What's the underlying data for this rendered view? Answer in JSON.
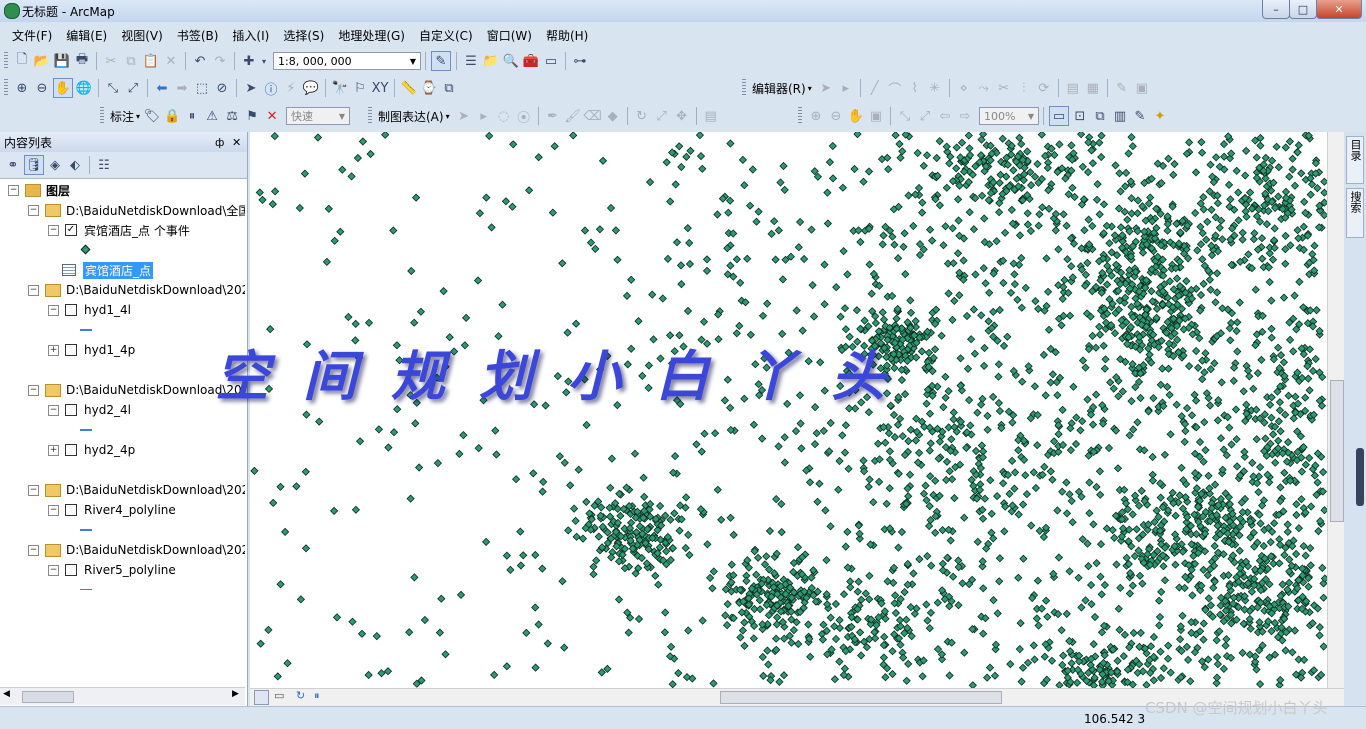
{
  "window": {
    "title": "无标题 - ArcMap",
    "minimize": "–",
    "maximize": "□",
    "close": "✕"
  },
  "menu": [
    "文件(F)",
    "编辑(E)",
    "视图(V)",
    "书签(B)",
    "插入(I)",
    "选择(S)",
    "地理处理(G)",
    "自定义(C)",
    "窗口(W)",
    "帮助(H)"
  ],
  "toolbar": {
    "scale": "1:8, 000, 000",
    "editor_label": "编辑器(R)",
    "label_label": "标注",
    "label_speed": "快速",
    "representation_label": "制图表达(A)",
    "zoom_percent": "100%"
  },
  "toc": {
    "title": "内容列表",
    "pin": "ф",
    "close": "✕",
    "root_label": "图层",
    "groups": [
      {
        "path": "D:\\BaiduNetdiskDownload\\全国",
        "layers": [
          {
            "name": "宾馆酒店_点 个事件",
            "checked": true,
            "symbol": "point"
          }
        ]
      },
      {
        "path": "D:\\BaiduNetdiskDownload\\202",
        "layers": [
          {
            "name": "hyd1_4l",
            "checked": false,
            "symbol": "line"
          },
          {
            "name": "hyd1_4p",
            "checked": false,
            "symbol": "none"
          }
        ]
      },
      {
        "path": "D:\\BaiduNetdiskDownload\\202",
        "layers": [
          {
            "name": "hyd2_4l",
            "checked": false,
            "symbol": "line"
          },
          {
            "name": "hyd2_4p",
            "checked": false,
            "symbol": "none"
          }
        ]
      },
      {
        "path": "D:\\BaiduNetdiskDownload\\202",
        "layers": [
          {
            "name": "River4_polyline",
            "checked": false,
            "symbol": "line"
          }
        ]
      },
      {
        "path": "D:\\BaiduNetdiskDownload\\202",
        "layers": [
          {
            "name": "River5_polyline",
            "checked": false,
            "symbol": "line"
          }
        ]
      }
    ],
    "table_name": "宾馆酒店_点"
  },
  "dock": {
    "catalog": "目录",
    "search": "搜索"
  },
  "watermark": "空间规划小白丫头",
  "status": {
    "coordinates": "106.542  3",
    "csdn": "CSDN @空间规划小白丫头"
  },
  "colors": {
    "point_fill": "#2e9a72",
    "point_stroke": "#0b2a20",
    "selection": "#3399ff",
    "watermark": "#3b47d8"
  }
}
